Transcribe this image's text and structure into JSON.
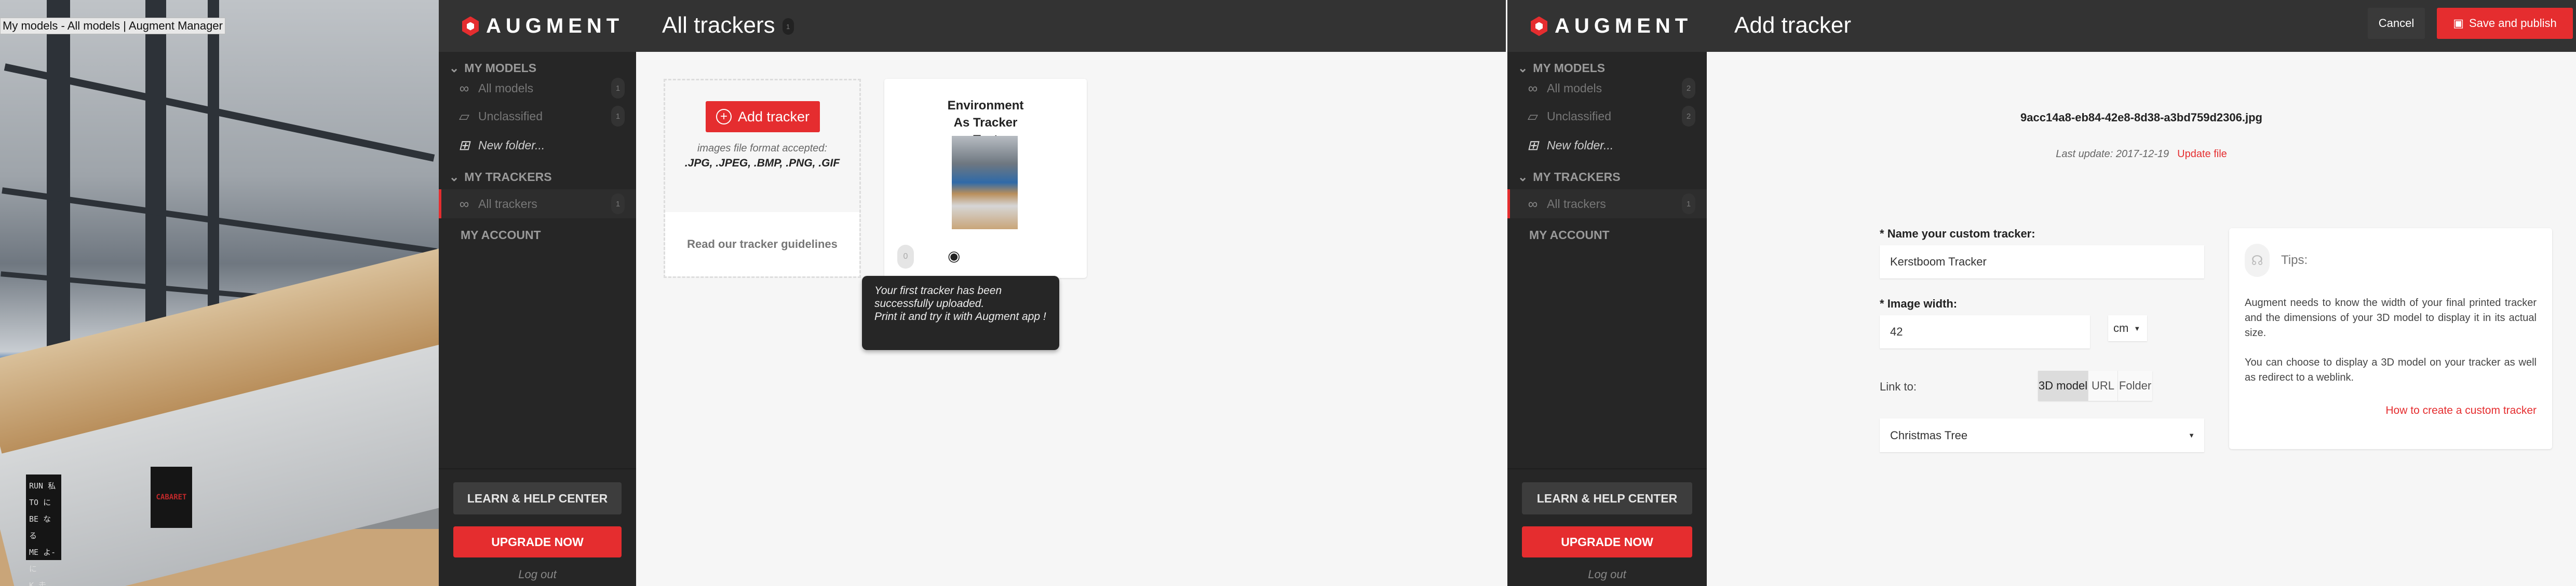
{
  "window_title": "My models - All models | Augment Manager",
  "photo": {
    "sign_left": [
      "RUN 私",
      "TO に",
      "BE なる",
      "ME よ-に",
      "K 走れ-!"
    ],
    "sign_right": "CABARET"
  },
  "brand": "AUGMENT",
  "left_app": {
    "page_title": "All trackers",
    "title_count": "1",
    "sidebar": {
      "my_models": "MY MODELS",
      "items": [
        {
          "label": "All models",
          "count": "1",
          "icon": "infinity-icon"
        },
        {
          "label": "Unclassified",
          "count": "1",
          "icon": "folder-unclassified-icon"
        },
        {
          "label": "New folder...",
          "icon": "folder-plus-icon"
        }
      ],
      "my_trackers": "MY TRACKERS",
      "trackers_item": {
        "label": "All trackers",
        "count": "1"
      },
      "my_account": "MY ACCOUNT",
      "learn": "LEARN & HELP CENTER",
      "upgrade": "UPGRADE NOW",
      "logout": "Log out"
    },
    "add_card": {
      "button": "Add tracker",
      "formats_label": "images file format accepted:",
      "formats": ".JPG, .JPEG, .BMP, .PNG, .GIF",
      "guidelines": "Read our tracker guidelines"
    },
    "tracker_card": {
      "title": "Environment As Tracker Test",
      "count": "0"
    },
    "tooltip": {
      "line1": "Your first tracker has been successfully uploaded.",
      "line2": "Print it and try it with Augment app !"
    }
  },
  "right_app": {
    "page_title": "Add tracker",
    "cancel": "Cancel",
    "save": "Save and publish",
    "sidebar": {
      "my_models": "MY MODELS",
      "items": [
        {
          "label": "All models",
          "count": "2"
        },
        {
          "label": "Unclassified",
          "count": "2"
        },
        {
          "label": "New folder..."
        }
      ],
      "my_trackers": "MY TRACKERS",
      "trackers_item": {
        "label": "All trackers",
        "count": "1"
      },
      "my_account": "MY ACCOUNT",
      "learn": "LEARN & HELP CENTER",
      "upgrade": "UPGRADE NOW",
      "logout": "Log out"
    },
    "filename": "9acc14a8-eb84-42e8-8d38-a3bd759d2306.jpg",
    "last_update_label": "Last update: 2017-12-19",
    "update_file": "Update file",
    "form": {
      "name_label": "Name your custom tracker:",
      "name_value": "Kerstboom Tracker",
      "width_label": "Image width:",
      "width_value": "42",
      "unit": "cm",
      "link_label": "Link to:",
      "link_options": [
        "3D model",
        "URL",
        "Folder"
      ],
      "link_selected": "3D model",
      "model_value": "Christmas Tree",
      "required_mark": "*"
    },
    "tips": {
      "title": "Tips:",
      "p1": "Augment needs to know the width of your final printed tracker and the dimensions of your 3D model to display it in its actual size.",
      "p2": "You can choose to display a 3D model on your tracker as well as redirect to a weblink.",
      "link": "How to create a custom tracker"
    }
  },
  "colors": {
    "accent": "#e52d2f",
    "header": "#333333",
    "sidebar": "#262626",
    "content": "#f6f6f6"
  }
}
